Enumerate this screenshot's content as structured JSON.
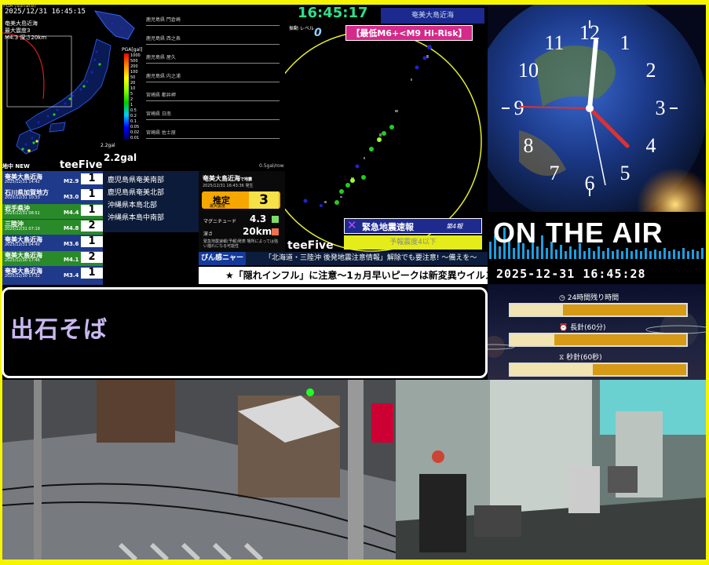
{
  "map": {
    "timestamp": "2025/12/31 16:45:15",
    "corner_label": "PGA (Surface)",
    "info_lines": [
      "奄美大島近海",
      "最大震度3",
      "M4.3 深さ20km"
    ],
    "pga_title": "PGA[gal]",
    "pga_labels": [
      "1000",
      "500",
      "200",
      "100",
      "50",
      "20",
      "10",
      "5",
      "2",
      "1",
      "0.5",
      "0.2",
      "0.1",
      "0.05",
      "0.02",
      "0.01"
    ],
    "gal_small": "2.2gal",
    "gal_big": "2.2gal"
  },
  "waveforms": {
    "stations": [
      "鹿児島県 門倉崎",
      "鹿児島県 西之表",
      "鹿児島県 屋久",
      "鹿児島県 内之浦",
      "宮崎県 都井岬",
      "宮崎県 日南",
      "宮崎県 佐土原"
    ],
    "scale": "0.5gal/row"
  },
  "quake_list": {
    "header": "地中 NEW",
    "brand": "teeFive",
    "items": [
      {
        "name": "奄美大島近海",
        "datetime": "2025/12/31 14:42",
        "mag": "M2.9",
        "intensity": "1"
      },
      {
        "name": "石川県加賀地方",
        "datetime": "2025/12/31 10:33",
        "mag": "M3.0",
        "intensity": "1"
      },
      {
        "name": "岩手県沖",
        "datetime": "2025/12/31 08:51",
        "mag": "M4.4",
        "intensity": "1"
      },
      {
        "name": "三陸沖",
        "datetime": "2025/12/31 07:19",
        "mag": "M4.8",
        "intensity": "2"
      },
      {
        "name": "奄美大島近海",
        "datetime": "2025/12/31 04:40",
        "mag": "M3.6",
        "intensity": "1"
      },
      {
        "name": "奄美大島近海",
        "datetime": "2025/12/30 17:46",
        "mag": "M4.1",
        "intensity": "2"
      },
      {
        "name": "奄美大島近海",
        "datetime": "2025/12/30 17:32",
        "mag": "M3.4",
        "intensity": "1"
      }
    ]
  },
  "regions": [
    "鹿児島県奄美南部",
    "鹿児島県奄美北部",
    "沖縄県本島北部",
    "沖縄県本島中南部"
  ],
  "estimate": {
    "title": "奄美大島近海",
    "title_suffix": "で地震",
    "time": "2025/12/31 16:43:36 発生",
    "label": "推定",
    "sublabel": "最大震度",
    "intensity": "3",
    "mag_label": "マグニチュード",
    "mag_value": "4.3",
    "depth_label": "深さ",
    "depth_value": "20km",
    "note": "緊急地震速報(予報)発表 場所によっては強い揺れになる可能性"
  },
  "top": {
    "clock": "16:45:17",
    "region": "奄美大島近海",
    "level_label": "振動 レベル",
    "level_value": "0",
    "risk_label": "【最低M6+<M9 Hi-Risk】"
  },
  "eew": {
    "label": "緊急地震速報",
    "number": "第4報",
    "warning": "予報震度4以下",
    "brand": "teeFive"
  },
  "ticker": {
    "tag": "ぴん感ニャース",
    "headline": "「北海道・三陸沖 後発地震注意情報」解除でも要注意! ～備えを～",
    "scroll": "★「隠れインフル」に注意～1ヵ月早いピークは新変異ウイルス"
  },
  "message": "出石そば",
  "clock_face": {
    "numbers": [
      "12",
      "1",
      "2",
      "3",
      "4",
      "5",
      "6",
      "7",
      "8",
      "9",
      "10",
      "11"
    ]
  },
  "onair": {
    "title": "ON THE AIR",
    "datetime": "2025-12-31 16:45:28",
    "bars": [
      {
        "label": "24時間残り時間",
        "icon": "clock-icon",
        "fraction": 0.3
      },
      {
        "label": "長針(60分)",
        "icon": "alarm-icon",
        "fraction": 0.25
      },
      {
        "label": "秒針(60秒)",
        "icon": "hourglass-icon",
        "fraction": 0.47
      }
    ]
  },
  "colors": {
    "frame": "#f5f500",
    "clock_green": "#2ee08a",
    "risk_pink": "#d42a8a",
    "eew_yellow": "#e4ec1a",
    "bar_gold": "#d69a16",
    "list_blue": "#1f3a8a"
  }
}
